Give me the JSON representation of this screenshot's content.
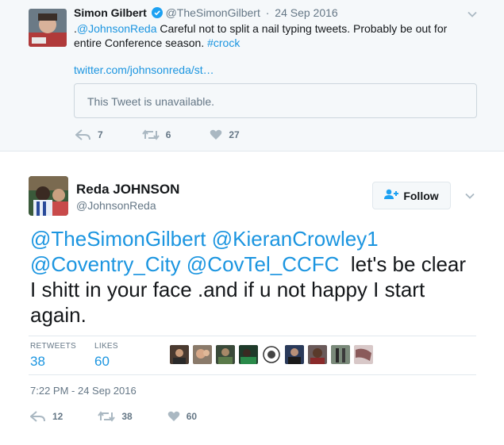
{
  "parent_tweet": {
    "name": "Simon Gilbert",
    "handle": "@TheSimonGilbert",
    "dot": "·",
    "time": "24 Sep 2016",
    "text_prefix": ".",
    "mention": "@JohnsonReda",
    "text_body": " Careful not to split a nail typing tweets. Probably be out for entire Conference season. ",
    "hashtag": "#crock",
    "url": "twitter.com/johnsonreda/st…",
    "quoted_unavailable": "This Tweet is unavailable.",
    "reply_count": "7",
    "retweet_count": "6",
    "like_count": "27"
  },
  "main_tweet": {
    "name": "Reda JOHNSON",
    "handle": "@JohnsonReda",
    "follow_label": "Follow",
    "mentions": [
      "@TheSimonGilbert",
      "@KieranCrowley1",
      "@Coventry_City",
      "@CovTel_CCFC"
    ],
    "text_body": "  let's be clear I shitt in your face .and if u not happy I start again.",
    "retweets_label": "RETWEETS",
    "retweets_value": "38",
    "likes_label": "LIKES",
    "likes_value": "60",
    "timestamp": "7:22 PM - 24 Sep 2016",
    "reply_count": "12",
    "retweet_count": "38",
    "like_count": "60"
  },
  "colors": {
    "link": "#1b95e0",
    "muted": "#657786",
    "verified": "#1da1f2",
    "parent_bg": "#f5f8fa"
  },
  "icons": [
    "verified-badge-icon",
    "chevron-down-icon",
    "reply-icon",
    "retweet-icon",
    "heart-icon",
    "follow-person-icon"
  ]
}
